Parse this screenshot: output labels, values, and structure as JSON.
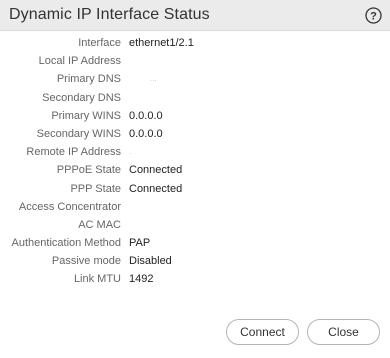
{
  "dialog": {
    "title": "Dynamic IP Interface Status",
    "help_icon": "question-circle-icon"
  },
  "fields": [
    {
      "label": "Interface",
      "value": "ethernet1/2.1"
    },
    {
      "label": "Local IP Address",
      "value": ""
    },
    {
      "label": "Primary DNS",
      "value": "..."
    },
    {
      "label": "Secondary DNS",
      "value": ""
    },
    {
      "label": "Primary WINS",
      "value": "0.0.0.0"
    },
    {
      "label": "Secondary WINS",
      "value": "0.0.0.0"
    },
    {
      "label": "Remote IP Address",
      "value": "."
    },
    {
      "label": "PPPoE State",
      "value": "Connected"
    },
    {
      "label": "PPP State",
      "value": "Connected"
    },
    {
      "label": "Access Concentrator",
      "value": ""
    },
    {
      "label": "AC MAC",
      "value": ""
    },
    {
      "label": "Authentication Method",
      "value": "PAP"
    },
    {
      "label": "Passive mode",
      "value": "Disabled"
    },
    {
      "label": "Link MTU",
      "value": "1492"
    }
  ],
  "buttons": {
    "connect": "Connect",
    "close": "Close"
  },
  "colors": {
    "title_bar": "#ebebeb",
    "label_text": "#666666",
    "value_text": "#222222",
    "button_border": "#b5b5b5"
  }
}
